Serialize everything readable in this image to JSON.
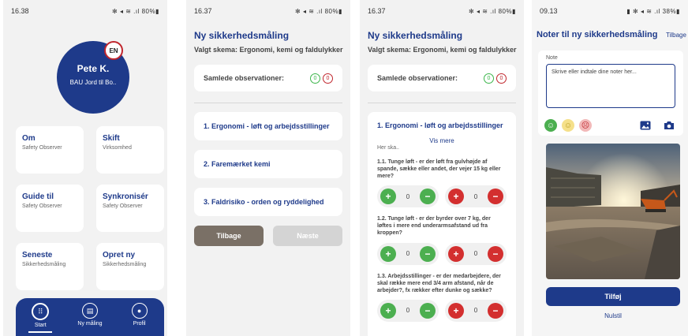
{
  "screen1": {
    "status": {
      "time": "16.38",
      "icons": "✻ ◂ ≋ .ıl 80%▮"
    },
    "profile": {
      "name": "Pete K.",
      "unit": "BAU Jord til Bo..",
      "language": "EN"
    },
    "tiles": [
      {
        "title": "Om",
        "subtitle": "Safety Observer"
      },
      {
        "title": "Skift",
        "subtitle": "Virksomhed"
      },
      {
        "title": "Guide til",
        "subtitle": "Safety Observer"
      },
      {
        "title": "Synkronisér",
        "subtitle": "Safety Observer"
      },
      {
        "title": "Seneste",
        "subtitle": "Sikkerhedsmåling"
      },
      {
        "title": "Opret ny",
        "subtitle": "Sikkerhedsmåling"
      }
    ],
    "nav": [
      {
        "label": "Start",
        "icon": "grid-icon"
      },
      {
        "label": "Ny måling",
        "icon": "clipboard-icon"
      },
      {
        "label": "Profil",
        "icon": "user-icon"
      }
    ]
  },
  "screen2": {
    "status": {
      "time": "16.37",
      "icons": "✻ ◂ ≋ .ıl 80%▮"
    },
    "title": "Ny sikkerhedsmåling",
    "schema": "Valgt skema: Ergonomi, kemi og faldulykker",
    "observations_label": "Samlede observationer:",
    "positive_count": "0",
    "negative_count": "0",
    "categories": [
      "1. Ergonomi - løft og arbejdsstillinger",
      "2. Faremærket kemi",
      "3. Faldrisiko - orden og ryddelighed"
    ],
    "back_label": "Tilbage",
    "next_label": "Næste"
  },
  "screen3": {
    "status": {
      "time": "16.37",
      "icons": "✻ ◂ ≋ .ıl 80%▮"
    },
    "title": "Ny sikkerhedsmåling",
    "schema": "Valgt skema: Ergonomi, kemi og faldulykker",
    "observations_label": "Samlede observationer:",
    "positive_count": "0",
    "negative_count": "0",
    "section_title": "1. Ergonomi - løft og arbejdsstillinger",
    "more_label": "Vis mere",
    "preview_text": "Her ska..",
    "questions": [
      {
        "text": "1.1. Tunge løft - er der løft fra gulvhøjde af spande, sække eller andet, der vejer 15 kg eller mere?",
        "positive": "0",
        "negative": "0"
      },
      {
        "text": "1.2. Tunge løft - er der byrder over 7 kg, der løftes i mere end underarmsafstand ud fra kroppen?",
        "positive": "0",
        "negative": "0"
      },
      {
        "text": "1.3. Arbejdsstillinger - er der medarbejdere, der skal række mere end 3/4 arm afstand, når de arbejder?, fx rækker efter dunke og sække?",
        "positive": "0",
        "negative": "0"
      }
    ]
  },
  "screen4": {
    "status": {
      "time": "09.13",
      "icons": "▮ ✻ ◂ ≋ .ıl 38%▮"
    },
    "title": "Noter til ny sikkerhedsmåling",
    "back_label": "Tilbage",
    "note_label": "Note",
    "note_placeholder": "Skrive eller indtale dine noter her...",
    "add_label": "Tilføj",
    "reset_label": "Nulstil"
  },
  "colors": {
    "navy": "#1e3a8a",
    "green": "#4caf50",
    "red": "#d32f2f",
    "back_button": "#7a7066"
  }
}
